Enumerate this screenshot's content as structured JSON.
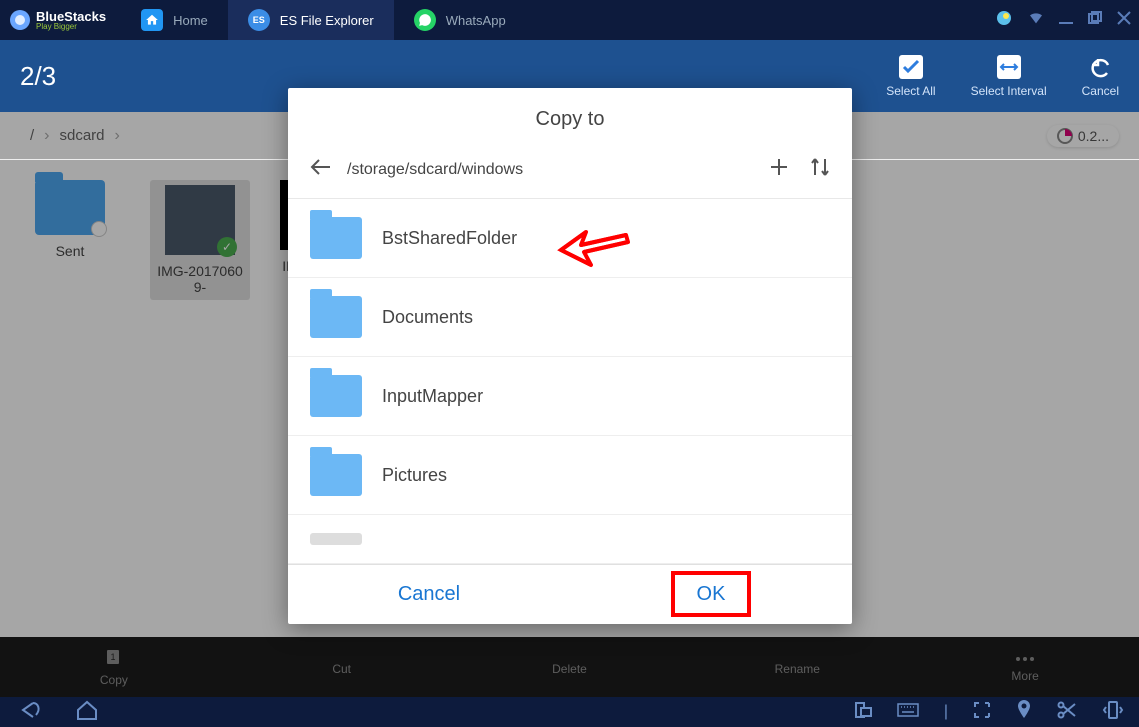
{
  "bluestacks": {
    "brand": "BlueStacks",
    "tagline": "Play Bigger",
    "tabs": [
      {
        "label": "Home",
        "active": false
      },
      {
        "label": "ES File Explorer",
        "active": true
      },
      {
        "label": "WhatsApp",
        "active": false
      }
    ]
  },
  "actionbar": {
    "count": "2/3",
    "select_all": "Select All",
    "select_interval": "Select Interval",
    "cancel": "Cancel"
  },
  "breadcrumb": {
    "root": "/",
    "path1": "sdcard",
    "badge": "0.2..."
  },
  "files": [
    {
      "name": "Sent",
      "type": "folder"
    },
    {
      "name": "IMG-20170609-",
      "type": "image_selected"
    },
    {
      "name": "IM",
      "type": "image_clipped"
    }
  ],
  "bottom": {
    "copy": "Copy",
    "cut": "Cut",
    "delete": "Delete",
    "rename": "Rename",
    "more": "More"
  },
  "dialog": {
    "title": "Copy to",
    "path": "/storage/sdcard/windows",
    "folders": [
      {
        "name": "BstSharedFolder"
      },
      {
        "name": "Documents"
      },
      {
        "name": "InputMapper"
      },
      {
        "name": "Pictures"
      }
    ],
    "cancel": "Cancel",
    "ok": "OK"
  }
}
